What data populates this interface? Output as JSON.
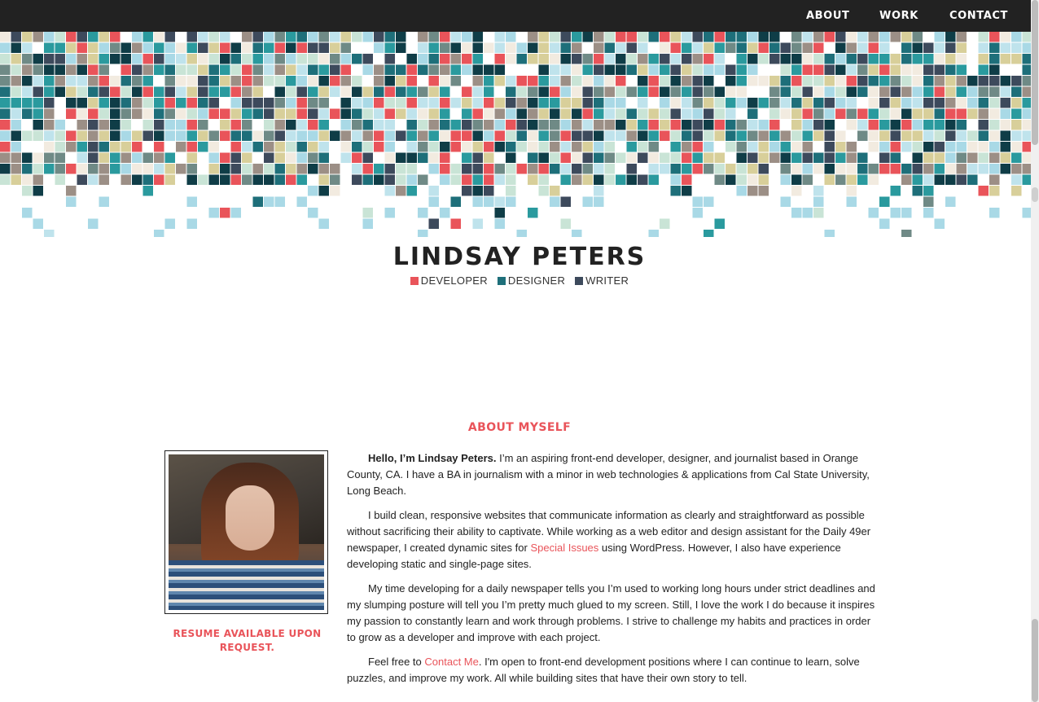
{
  "colors": {
    "accent": "#e9545a",
    "nav_bg": "#222222",
    "developer": "#e9545a",
    "designer": "#1e6f7a",
    "writer": "#3d4a5c",
    "mosaic_palette": [
      "#e9545a",
      "#1e6f7a",
      "#2a9a9e",
      "#3d4a5c",
      "#bfe3ec",
      "#a9d9e6",
      "#d8cf9a",
      "#f2ebe0",
      "#6f8a86",
      "#0f3d47",
      "#c9e4d6",
      "#9c8f86",
      "#ffffff"
    ]
  },
  "nav": {
    "items": [
      {
        "label": "ABOUT"
      },
      {
        "label": "WORK"
      },
      {
        "label": "CONTACT"
      }
    ]
  },
  "hero": {
    "name": "LINDSAY PETERS",
    "roles": [
      {
        "label": "DEVELOPER"
      },
      {
        "label": "DESIGNER"
      },
      {
        "label": "WRITER"
      }
    ]
  },
  "about": {
    "title": "ABOUT MYSELF",
    "resume_note": "RESUME AVAILABLE UPON REQUEST.",
    "p1_bold": "Hello, I’m Lindsay Peters.",
    "p1_text": " I’m an aspiring front-end developer, designer, and journalist based in Orange County, CA. I have a BA in journalism with a minor in web technologies & applications from Cal State University, Long Beach.",
    "p2_before": "I build clean, responsive websites that communicate information as clearly and straightforward as possible without sacrificing their ability to captivate. While working as a web editor and design assistant for the Daily 49er newspaper, I created dynamic sites for ",
    "p2_link": "Special Issues",
    "p2_after": " using WordPress. However, I also have experience developing static and single-page sites.",
    "p3": "My time developing for a daily newspaper tells you I’m used to working long hours under strict deadlines and my slumping posture will tell you I’m pretty much glued to my screen. Still, I love the work I do because it inspires my passion to constantly learn and work through problems. I strive to challenge my habits and practices in order to grow as a developer and improve with each project.",
    "p4_before": "Feel free to ",
    "p4_link": "Contact Me",
    "p4_after": ". I'm open to front-end development positions where I can continue to learn, solve puzzles, and improve my work. All while building sites that have their own story to tell."
  }
}
